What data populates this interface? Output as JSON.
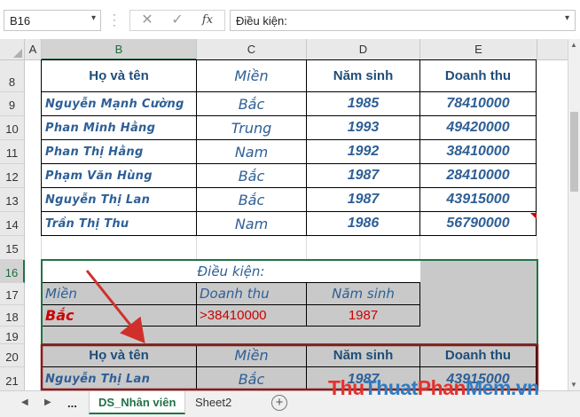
{
  "formula_bar": {
    "name_box": "B16",
    "cancel_icon": "✕",
    "enter_icon": "✓",
    "fx_label": "fx",
    "content": "Điều kiện:"
  },
  "columns": [
    "A",
    "B",
    "C",
    "D",
    "E"
  ],
  "rows": [
    "8",
    "9",
    "10",
    "11",
    "12",
    "13",
    "14",
    "15",
    "16",
    "17",
    "18",
    "19",
    "20",
    "21"
  ],
  "table": {
    "headers": [
      "Họ và tên",
      "Miền",
      "Năm sinh",
      "Doanh thu"
    ],
    "records": [
      [
        "Nguyễn  Mạnh Cường",
        "Bắc",
        "1985",
        "78410000"
      ],
      [
        "Phan  Minh Hằng",
        "Trung",
        "1993",
        "49420000"
      ],
      [
        "Phan  Thị Hằng",
        "Nam",
        "1992",
        "38410000"
      ],
      [
        "Phạm  Văn Hùng",
        "Bắc",
        "1987",
        "28410000"
      ],
      [
        "Nguyễn  Thị Lan",
        "Bắc",
        "1987",
        "43915000"
      ],
      [
        "Trần  Thị Thu",
        "Nam",
        "1986",
        "56790000"
      ]
    ]
  },
  "criteria": {
    "title": "Điều kiện:",
    "headers": [
      "Miền",
      "Doanh thu",
      "Năm sinh"
    ],
    "values": [
      "Bắc",
      ">38410000",
      "1987"
    ]
  },
  "result": {
    "headers": [
      "Họ và tên",
      "Miền",
      "Năm sinh",
      "Doanh thu"
    ],
    "records": [
      [
        "Nguyễn  Thị Lan",
        "Bắc",
        "1987",
        "43915000"
      ]
    ]
  },
  "sheet_tabs": {
    "ellipsis": "...",
    "tabs": [
      "DS_Nhân viên",
      "Sheet2"
    ],
    "add": "+"
  },
  "watermark": {
    "part1": "Thu",
    "part2": "Thuat",
    "part3": "Phan",
    "part4": "Mem",
    "part5": ".vn"
  },
  "colors": {
    "accent": "#217346",
    "text_blue": "#2e5f96",
    "criteria_red": "#cc0000",
    "arrow_red": "#d0302b",
    "criteria_fill": "#c9c9c9",
    "result_outline": "#8b1a1a"
  }
}
